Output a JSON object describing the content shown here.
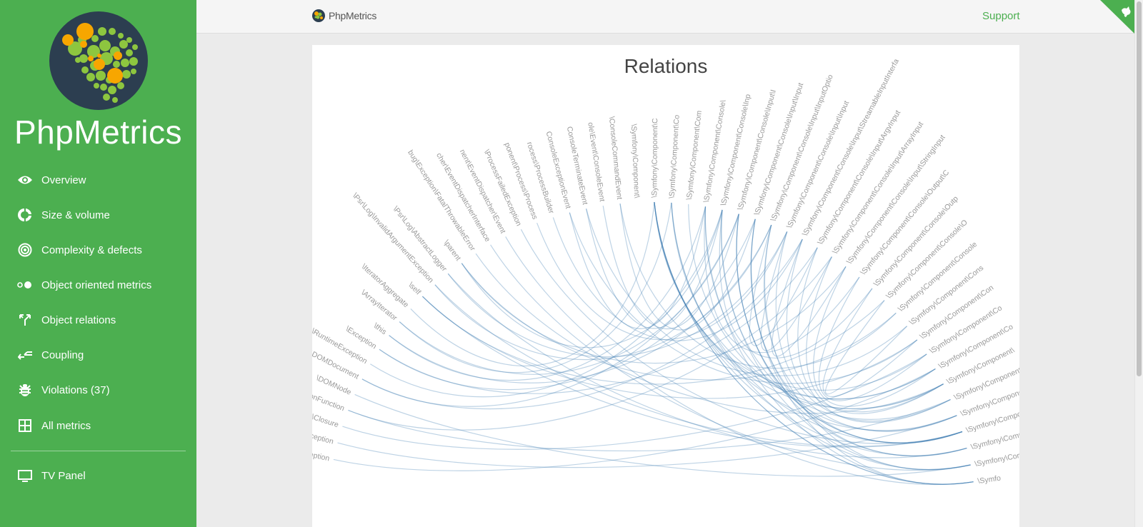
{
  "sidebar": {
    "app_name": "PhpMetrics",
    "items": [
      {
        "label": "Overview",
        "icon": "eye-icon"
      },
      {
        "label": "Size & volume",
        "icon": "donut-chart-icon"
      },
      {
        "label": "Complexity & defects",
        "icon": "target-icon"
      },
      {
        "label": "Object oriented metrics",
        "icon": "dots-icon"
      },
      {
        "label": "Object relations",
        "icon": "fork-icon"
      },
      {
        "label": "Coupling",
        "icon": "merge-arrow-icon"
      },
      {
        "label": "Violations (37)",
        "icon": "bug-icon"
      },
      {
        "label": "All metrics",
        "icon": "grid-icon"
      }
    ],
    "tv_panel": {
      "label": "TV Panel",
      "icon": "monitor-icon"
    }
  },
  "header": {
    "brand": "PhpMetrics",
    "support": "Support"
  },
  "main": {
    "title": "Relations"
  },
  "colors": {
    "sidebar": "#4caf50",
    "accent": "#4caf50",
    "link": "#4682b4",
    "label": "#999999"
  },
  "chart_data": {
    "type": "hierarchical-edge-bundling",
    "nodes": [
      "\\LogicException",
      "alidArgumentException",
      "\\Closure",
      "\\ReflectionFunction",
      "\\DOMNode",
      "\\DOMDocument",
      "\\RuntimeException",
      "\\Exception",
      "\\this",
      "\\ArrayIterator",
      "\\IteratorAggregate",
      "\\self",
      "\\Psr\\Log\\InvalidArgumentException",
      "\\Psr\\Log\\AbstractLogger",
      "\\parent",
      "bug\\Exception\\FatalThrowableError",
      "cher\\EventDispatcherInterface",
      "nent\\EventDispatcher\\Event",
      "\\ProcessFailedException",
      "ponent\\Process\\Process",
      "rocess\\ProcessBuilder",
      "ConsoleExceptionEvent",
      "ConsoleTerminateEvent",
      "ole\\Event\\ConsoleEvent",
      "\\ConsoleCommandEvent",
      "\\Symfony\\Component\\",
      "\\Symfony\\Component\\C",
      "\\Symfony\\Component\\Co",
      "\\Symfony\\Component\\Com",
      "\\Symfony\\Component\\Console\\",
      "\\Symfony\\Component\\Console\\Inp",
      "\\Symfony\\Component\\Console\\Input\\I",
      "\\Symfony\\Component\\Console\\Input\\Input",
      "\\Symfony\\Component\\Console\\Input\\InputOptio",
      "\\Symfony\\Component\\Console\\Input\\Input",
      "\\Symfony\\Component\\Console\\Input\\StreamableInputInterfa",
      "\\Symfony\\Component\\Console\\Input\\ArgvInput",
      "\\Symfony\\Component\\Console\\Input\\ArrayInput",
      "\\Symfony\\Component\\Console\\Input\\StringInput",
      "\\Symfony\\Component\\Console\\Output\\C",
      "\\Symfony\\Component\\Console\\Outp",
      "\\Symfony\\Component\\Console\\O",
      "\\Symfony\\Component\\Console",
      "\\Symfony\\Component\\Cons",
      "\\Symfony\\Component\\Con",
      "\\Symfony\\Component\\Co",
      "\\Symfony\\Component\\Co",
      "\\Symfony\\Component\\",
      "\\Symfony\\Component\\",
      "\\Symfony\\Component\\I",
      "\\Symfony\\Component\\C",
      "\\Symfony\\Component\\Co",
      "\\Symfony\\Component\\Co",
      "\\Symfo"
    ],
    "links": [
      [
        14,
        42
      ],
      [
        14,
        38
      ],
      [
        14,
        30
      ],
      [
        11,
        41
      ],
      [
        11,
        50
      ],
      [
        11,
        44
      ],
      [
        9,
        31
      ],
      [
        8,
        33
      ],
      [
        7,
        36
      ],
      [
        6,
        30
      ],
      [
        5,
        31
      ],
      [
        4,
        52
      ],
      [
        3,
        48
      ],
      [
        2,
        45
      ],
      [
        1,
        49
      ],
      [
        0,
        46
      ],
      [
        12,
        50
      ],
      [
        13,
        51
      ],
      [
        15,
        47
      ],
      [
        16,
        52
      ],
      [
        17,
        53
      ],
      [
        18,
        50
      ],
      [
        21,
        29
      ],
      [
        22,
        30
      ],
      [
        23,
        31
      ],
      [
        24,
        32
      ],
      [
        19,
        34
      ],
      [
        20,
        35
      ],
      [
        26,
        49
      ],
      [
        26,
        51
      ],
      [
        26,
        46
      ],
      [
        27,
        52
      ],
      [
        28,
        47
      ],
      [
        26,
        53
      ],
      [
        29,
        39
      ],
      [
        30,
        40
      ],
      [
        31,
        50
      ],
      [
        32,
        53
      ],
      [
        33,
        36
      ],
      [
        34,
        37
      ],
      [
        35,
        38
      ],
      [
        36,
        48
      ],
      [
        37,
        47
      ],
      [
        38,
        46
      ],
      [
        39,
        45
      ],
      [
        40,
        44
      ],
      [
        41,
        43
      ],
      [
        42,
        24
      ],
      [
        43,
        22
      ],
      [
        44,
        21
      ],
      [
        45,
        26
      ],
      [
        46,
        27
      ],
      [
        47,
        26
      ],
      [
        48,
        29
      ],
      [
        49,
        30
      ],
      [
        50,
        31
      ],
      [
        51,
        32
      ],
      [
        52,
        33
      ],
      [
        53,
        26
      ],
      [
        27,
        50
      ],
      [
        29,
        53
      ],
      [
        30,
        52
      ],
      [
        31,
        51
      ],
      [
        32,
        50
      ],
      [
        33,
        49
      ],
      [
        34,
        48
      ],
      [
        35,
        47
      ],
      [
        12,
        33
      ],
      [
        13,
        34
      ],
      [
        10,
        26
      ],
      [
        9,
        27
      ],
      [
        8,
        29
      ],
      [
        7,
        32
      ],
      [
        5,
        35
      ],
      [
        3,
        37
      ]
    ]
  }
}
